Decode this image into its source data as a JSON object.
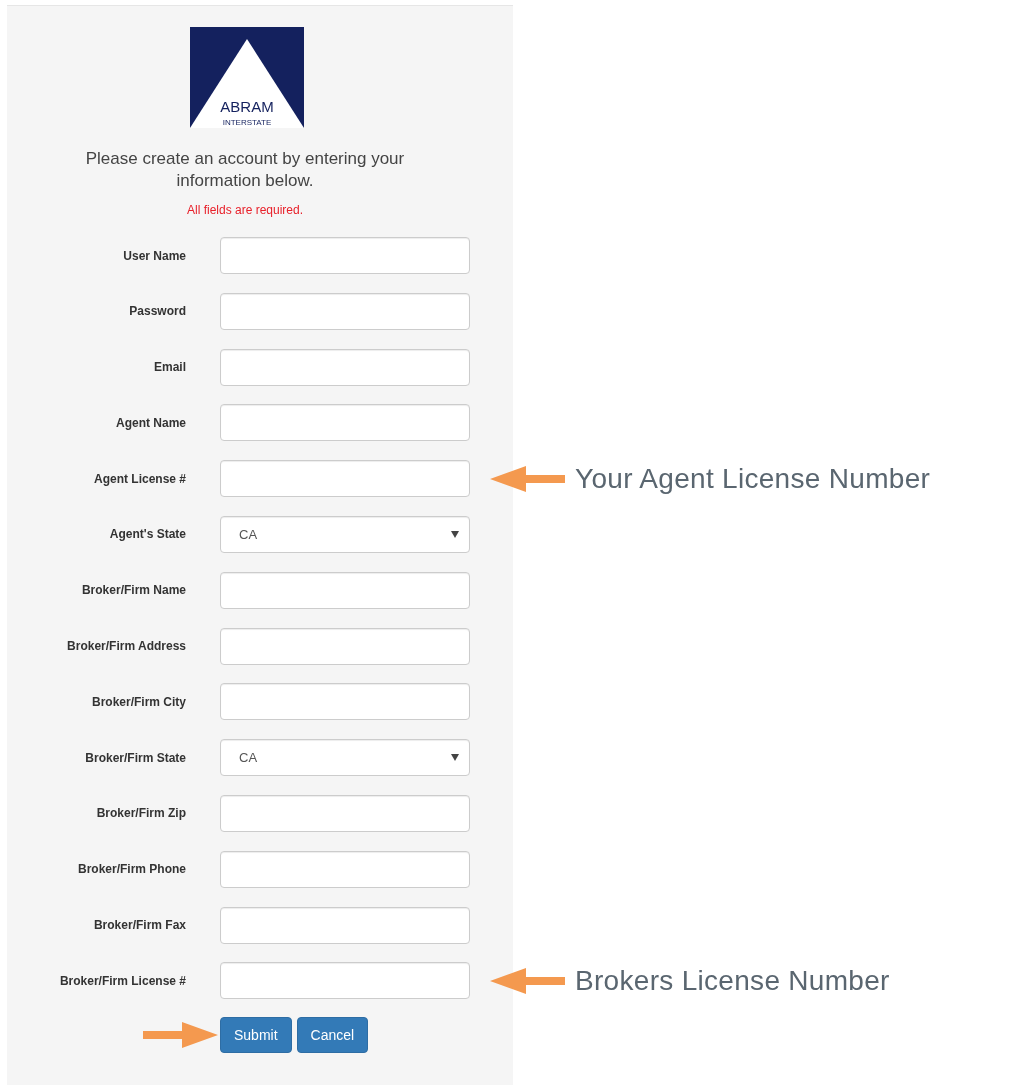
{
  "logo": {
    "name": "ABRAM",
    "subtitle": "INTERSTATE"
  },
  "intro": "Please create an account by entering your information below.",
  "required_note": "All fields are required.",
  "fields": [
    {
      "label": "User Name",
      "kind": "text"
    },
    {
      "label": "Password",
      "kind": "text"
    },
    {
      "label": "Email",
      "kind": "text"
    },
    {
      "label": "Agent Name",
      "kind": "text"
    },
    {
      "label": "Agent License #",
      "kind": "text",
      "annotation": "Your Agent License Number"
    },
    {
      "label": "Agent's State",
      "kind": "select",
      "value": "CA"
    },
    {
      "label": "Broker/Firm Name",
      "kind": "text"
    },
    {
      "label": "Broker/Firm Address",
      "kind": "text"
    },
    {
      "label": "Broker/Firm City",
      "kind": "text"
    },
    {
      "label": "Broker/Firm State",
      "kind": "select",
      "value": "CA"
    },
    {
      "label": "Broker/Firm Zip",
      "kind": "text"
    },
    {
      "label": "Broker/Firm Phone",
      "kind": "text"
    },
    {
      "label": "Broker/Firm Fax",
      "kind": "text"
    },
    {
      "label": "Broker/Firm License #",
      "kind": "text",
      "annotation": "Brokers License Number"
    }
  ],
  "buttons": [
    {
      "label": "Submit",
      "pointed_at": true
    },
    {
      "label": "Cancel",
      "pointed_at": false
    }
  ]
}
